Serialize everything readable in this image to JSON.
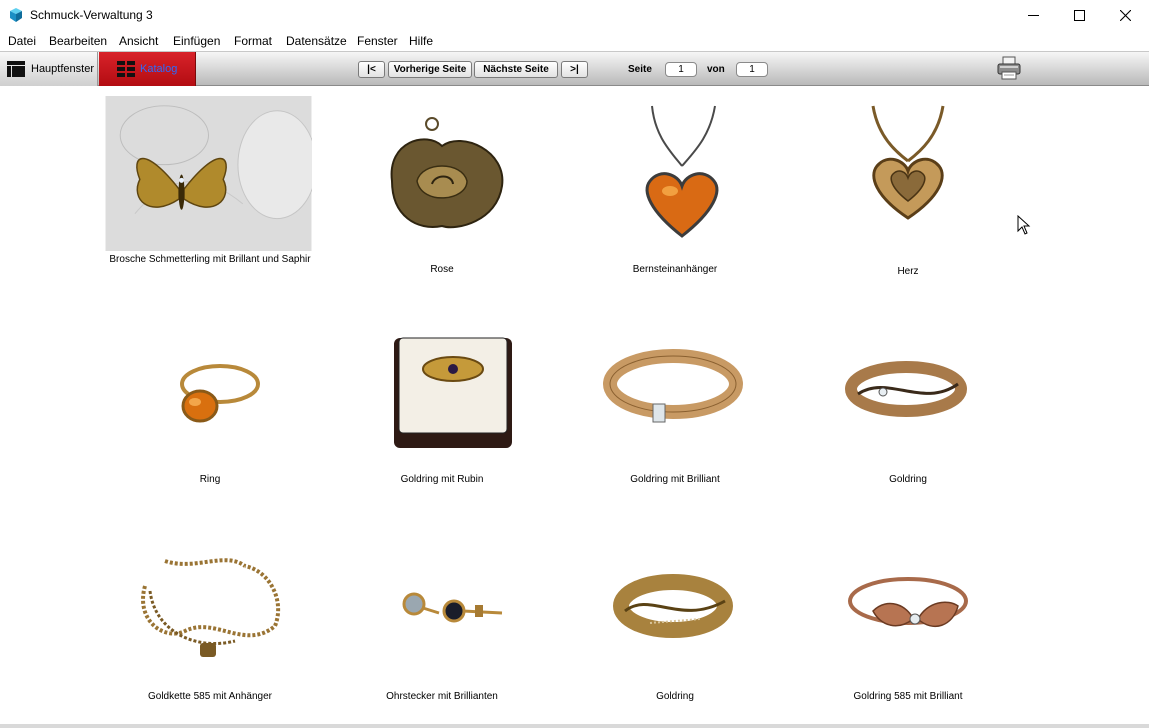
{
  "window": {
    "title": "Schmuck-Verwaltung 3",
    "controls": {
      "minimize": "—",
      "maximize": "☐",
      "close": "✕"
    }
  },
  "menu": [
    "Datei",
    "Bearbeiten",
    "Ansicht",
    "Einfügen",
    "Format",
    "Datensätze",
    "Fenster",
    "Hilfe"
  ],
  "toolbar": {
    "tabs": {
      "main": "Hauptfenster",
      "katalog": "Katalog"
    },
    "nav": {
      "first": "|<",
      "prev": "Vorherige Seite",
      "next": "Nächste Seite",
      "last": ">|"
    },
    "page": {
      "label": "Seite",
      "current": "1",
      "of_label": "von",
      "total": "1"
    },
    "print_icon": "printer-icon"
  },
  "catalog": {
    "items": [
      {
        "caption": "Brosche Schmetterling mit Brillant und Saphir",
        "icon": "butterfly-brooch"
      },
      {
        "caption": "Rose",
        "icon": "rose-pendant"
      },
      {
        "caption": "Bernsteinanhänger",
        "icon": "amber-heart-pendant"
      },
      {
        "caption": "Herz",
        "icon": "gold-heart-pendant"
      },
      {
        "caption": "Ring",
        "icon": "amber-ring"
      },
      {
        "caption": "Goldring mit Rubin",
        "icon": "ring-in-box"
      },
      {
        "caption": "Goldring mit Brilliant",
        "icon": "gold-band-diamond"
      },
      {
        "caption": "Goldring",
        "icon": "gold-ring-crossover"
      },
      {
        "caption": "Goldkette 585 mit Anhänger",
        "icon": "gold-chain"
      },
      {
        "caption": "Ohrstecker mit Brillianten",
        "icon": "stud-earrings"
      },
      {
        "caption": "Goldring",
        "icon": "gold-ring-wave"
      },
      {
        "caption": "Goldring 585 mit Brilliant",
        "icon": "rose-gold-ring"
      }
    ]
  },
  "colors": {
    "accent_tab": "#c4161c",
    "tab_link": "#2a6cff",
    "gold": "#b8893a",
    "amber": "#d96a14"
  }
}
